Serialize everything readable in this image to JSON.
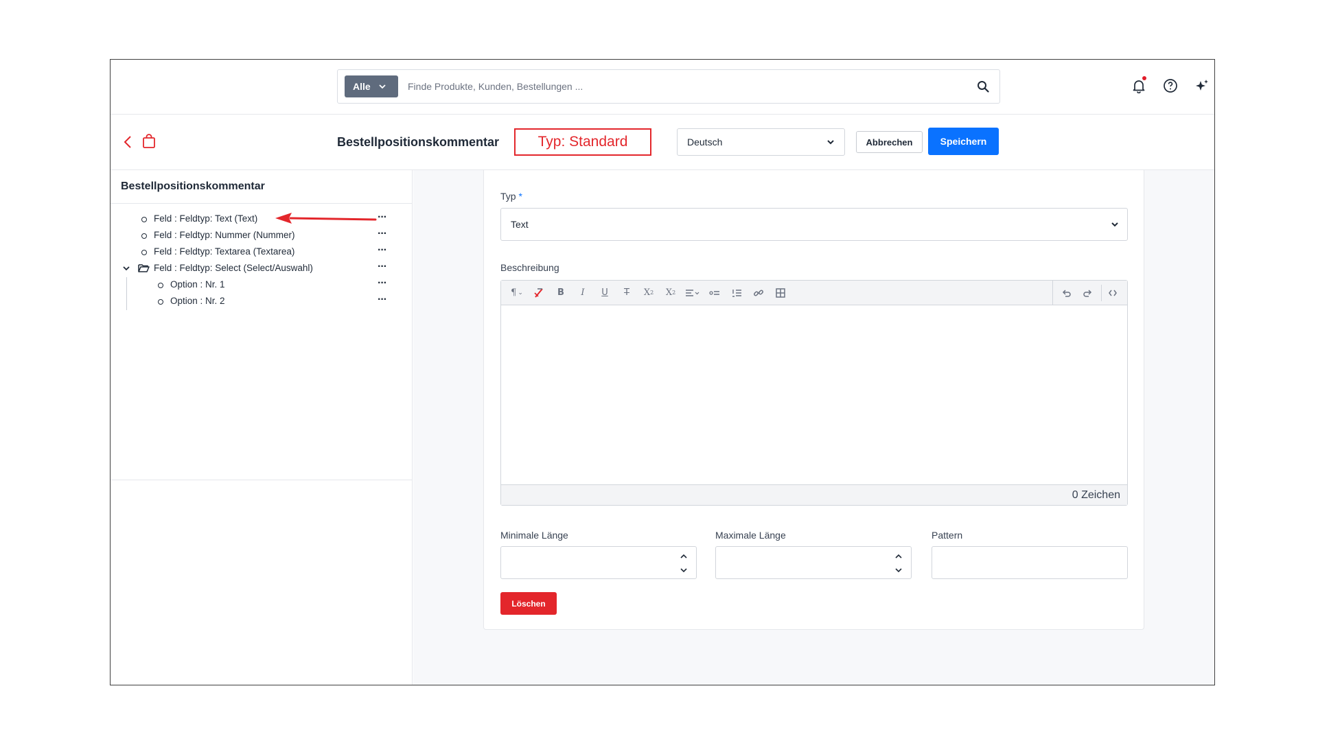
{
  "search": {
    "scope_label": "Alle",
    "placeholder": "Finde Produkte, Kunden, Bestellungen ..."
  },
  "header": {
    "title": "Bestellpositionskommentar",
    "type_label": "Typ: Standard",
    "language": "Deutsch",
    "cancel_label": "Abbrechen",
    "save_label": "Speichern"
  },
  "tree": {
    "title": "Bestellpositionskommentar",
    "items": [
      {
        "label": "Feld : Feldtyp: Text (Text)"
      },
      {
        "label": "Feld : Feldtyp: Nummer (Nummer)"
      },
      {
        "label": "Feld : Feldtyp: Textarea (Textarea)"
      },
      {
        "label": "Feld : Feldtyp: Select (Select/Auswahl)"
      },
      {
        "label": "Option : Nr. 1"
      },
      {
        "label": "Option : Nr. 2"
      }
    ],
    "more_label": "···"
  },
  "form": {
    "type_label": "Typ",
    "required_marker": "*",
    "type_value": "Text",
    "description_label": "Beschreibung",
    "char_count": "0 Zeichen",
    "min_length_label": "Minimale Länge",
    "max_length_label": "Maximale Länge",
    "pattern_label": "Pattern",
    "delete_label": "Löschen"
  },
  "icons": {
    "search": "search-icon",
    "bell": "bell-icon",
    "help": "help-icon",
    "ai": "sparkle-icon"
  },
  "colors": {
    "primary": "#0a72ff",
    "danger": "#e3262b",
    "scope_bg": "#5f6b7d"
  }
}
